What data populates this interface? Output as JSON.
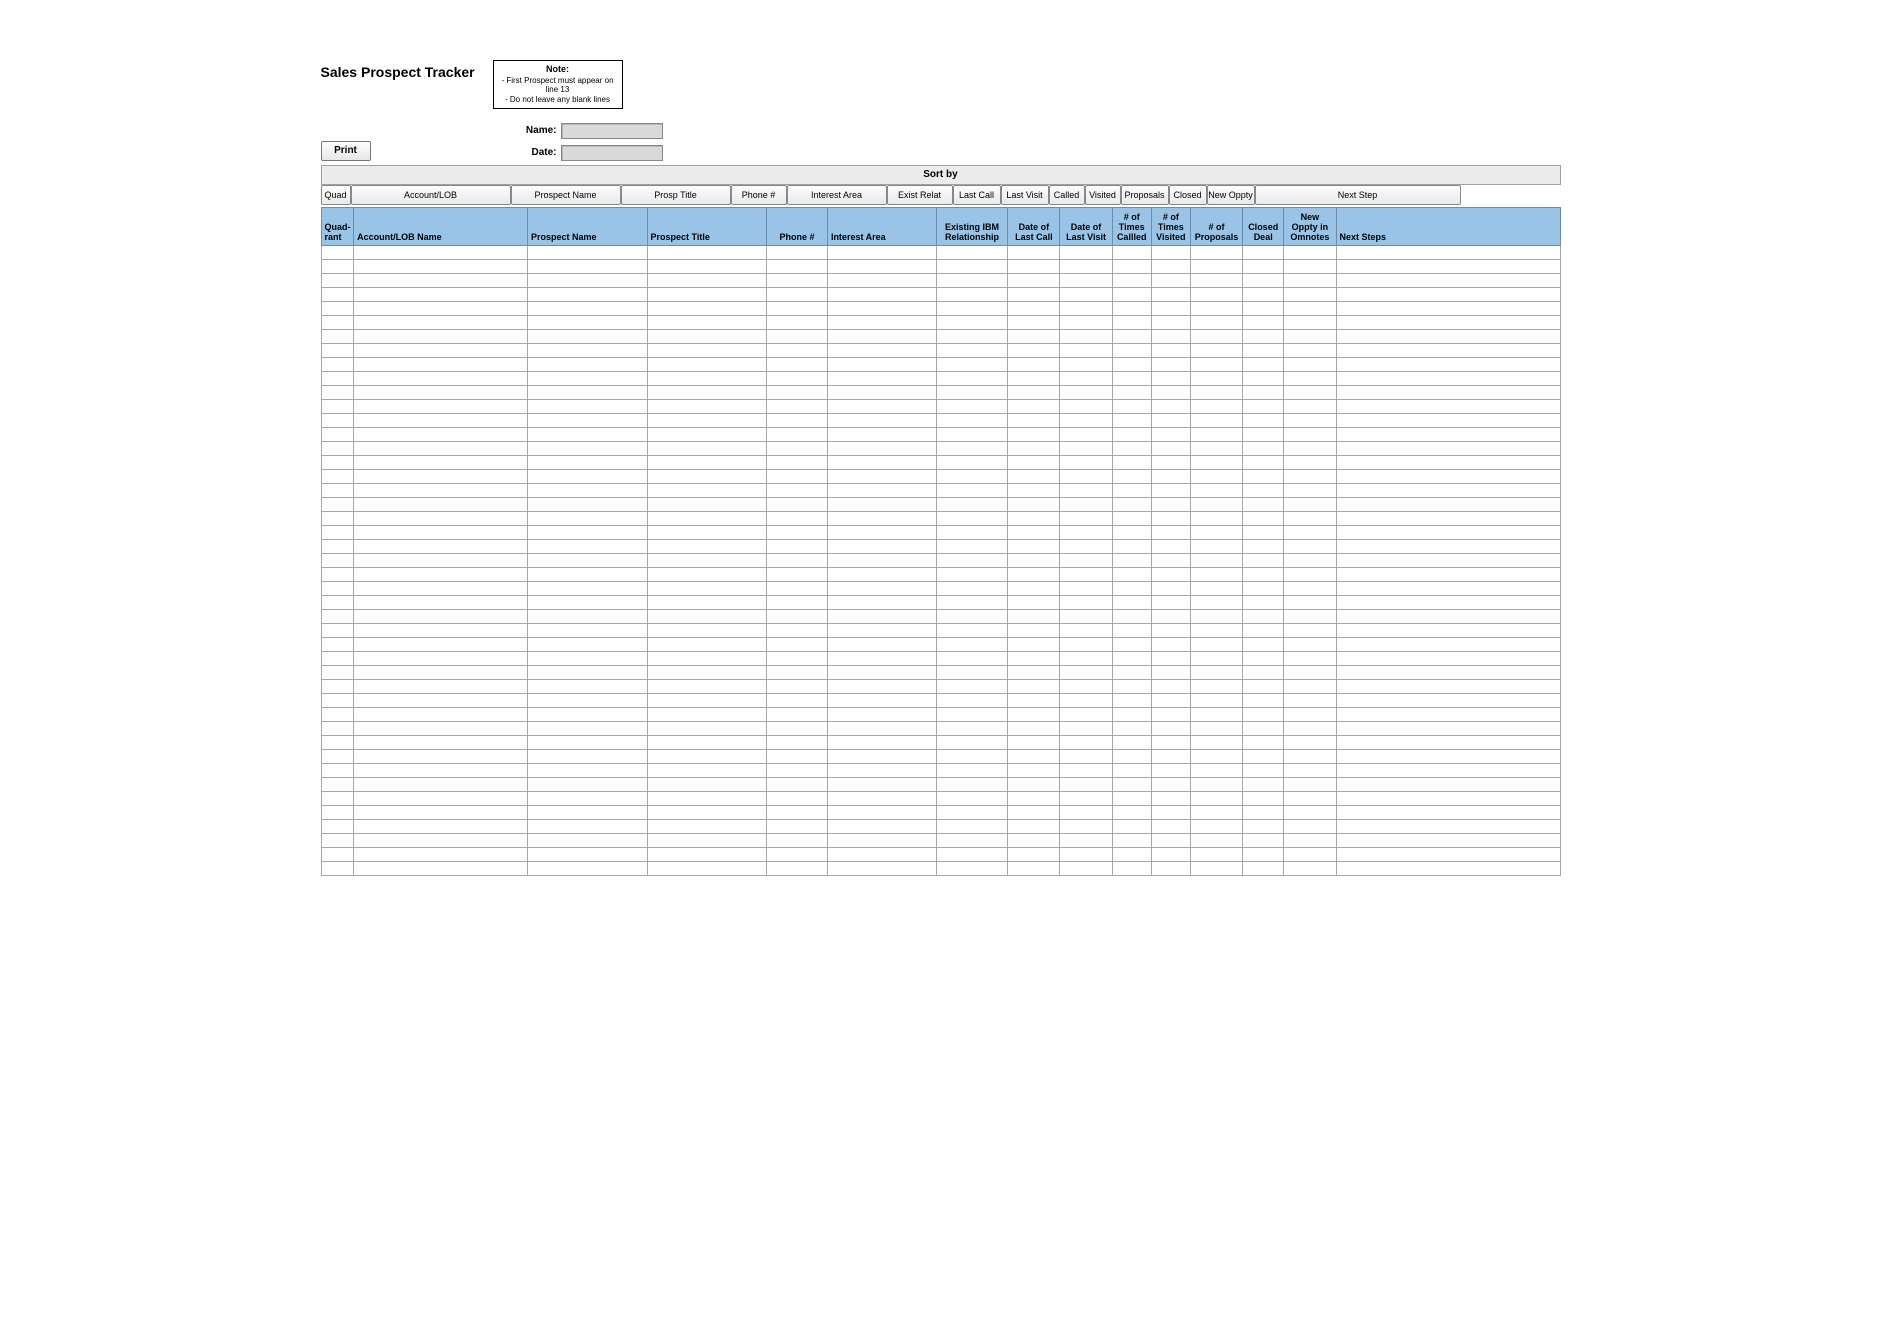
{
  "header": {
    "title": "Sales Prospect Tracker",
    "note": {
      "label": "Note:",
      "line1": "- First Prospect must appear on line 13",
      "line2": "- Do not leave any blank lines"
    },
    "name_label": "Name:",
    "name_value": "",
    "date_label": "Date:",
    "date_value": "",
    "print_label": "Print"
  },
  "sort": {
    "title": "Sort by",
    "buttons": [
      "Quad",
      "Account/LOB",
      "Prospect Name",
      "Prosp Title",
      "Phone #",
      "Interest Area",
      "Exist Relat",
      "Last Call",
      "Last Visit",
      "Called",
      "Visited",
      "Proposals",
      "Closed",
      "New Oppty",
      "Next Step"
    ]
  },
  "columns": [
    "Quad-rant",
    "Account/LOB Name",
    "Prospect Name",
    "Prospect Title",
    "Phone #",
    "Interest Area",
    "Existing IBM Relationship",
    "Date of Last Call",
    "Date of Last Visit",
    "# of Times Callled",
    "# of Times Visited",
    "# of Proposals",
    "Closed Deal",
    "New Oppty in Omnotes",
    "Next Steps"
  ],
  "row_count": 45
}
